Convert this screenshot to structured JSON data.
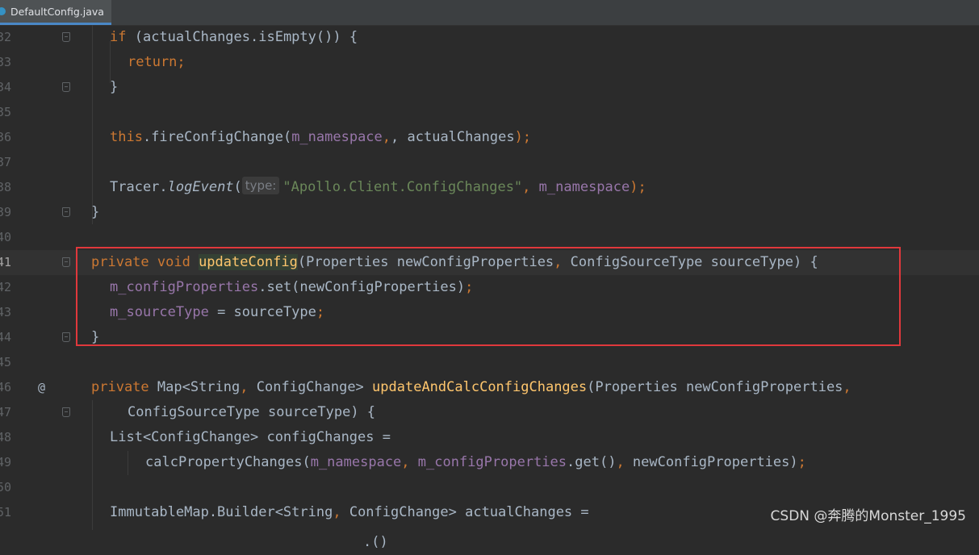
{
  "tab": {
    "filename": "DefaultConfig.java"
  },
  "parameter_hint": "type:",
  "code": {
    "ln32": "32",
    "ln33": "33",
    "ln34": "34",
    "ln35": "35",
    "ln36": "36",
    "ln37": "37",
    "ln38": "38",
    "ln39": "39",
    "ln40": "40",
    "ln41": "41",
    "ln42": "42",
    "ln43": "43",
    "ln44": "44",
    "ln45": "45",
    "ln46": "46",
    "ln47": "47",
    "ln48": "48",
    "ln49": "49",
    "ln50": "50",
    "ln51": "51",
    "l32": [
      "if",
      " (actualChanges.isEmpty()) {"
    ],
    "l33": [
      "return",
      ";"
    ],
    "l34": "}",
    "l36": [
      "this",
      ".fireConfigChange(",
      "m_namespace",
      ", actualChanges",
      ");"
    ],
    "l38": [
      "Tracer.",
      "logEvent",
      "(",
      "\"Apollo.Client.ConfigChanges\"",
      ", ",
      "m_namespace",
      ");"
    ],
    "l39": "}",
    "l41": [
      "private void ",
      "updateConfig",
      "(Properties newConfigProperties",
      ", ",
      "ConfigSourceType sourceType) {"
    ],
    "l42": [
      "m_configProperties",
      ".set(newConfigProperties)",
      ";"
    ],
    "l43": [
      "m_sourceType",
      " = sourceType",
      ";"
    ],
    "l44": "}",
    "l46": [
      "private ",
      "Map<String",
      ", ",
      "ConfigChange> ",
      "updateAndCalcConfigChanges",
      "(Properties newConfigProperties",
      ","
    ],
    "l47": "ConfigSourceType sourceType) {",
    "l48": "List<ConfigChange> configChanges =",
    "l49": [
      "calcPropertyChanges(",
      "m_namespace",
      ", ",
      "m_configProperties",
      ".get()",
      ", ",
      "newConfigProperties)",
      ";"
    ],
    "l51": [
      "ImmutableMap.Builder<String",
      ", ",
      "ConfigChange> actualChanges ="
    ],
    "l52_partial": ".()"
  },
  "gutter_marker": "@",
  "watermark": "CSDN @奔腾的Monster_1995",
  "colors": {
    "background": "#2b2b2b",
    "keyword": "#cc7832",
    "field": "#9876aa",
    "string": "#6a8759",
    "method_decl": "#ffc66d",
    "default_text": "#a9b7c6",
    "highlight_box": "#e0383c"
  }
}
